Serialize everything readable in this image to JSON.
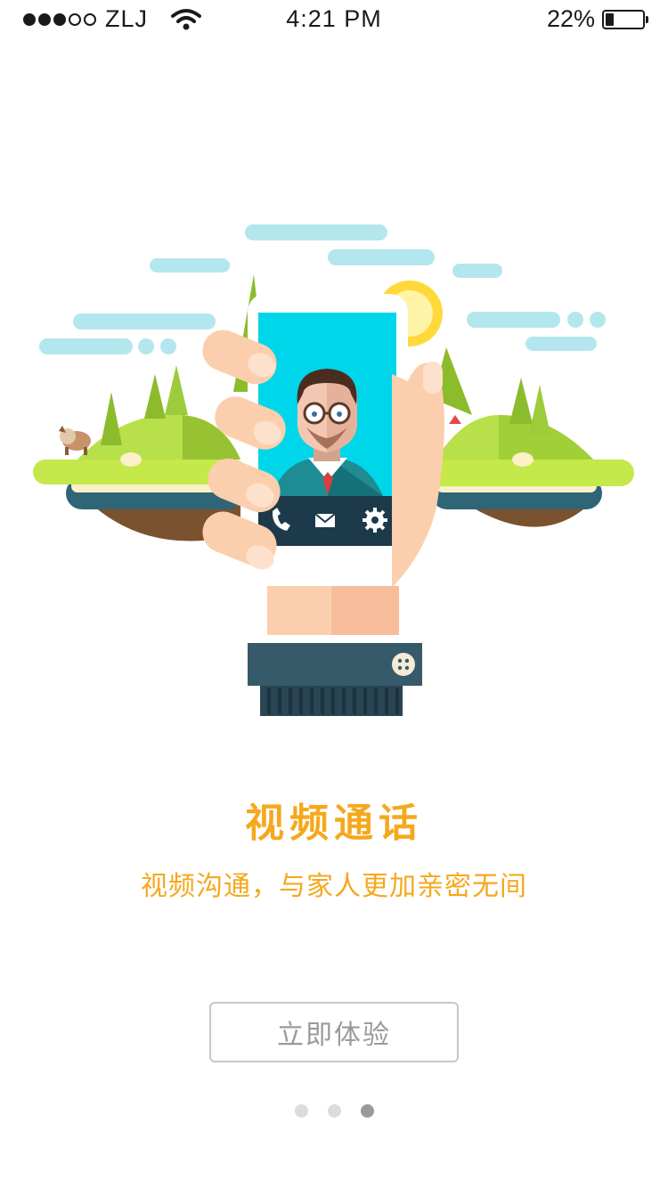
{
  "status_bar": {
    "signal_filled": 3,
    "signal_total": 5,
    "carrier": "ZLJ",
    "time": "4:21 PM",
    "battery_text": "22%",
    "battery_level": 0.22
  },
  "illustration": {
    "icons": [
      "phone-icon",
      "mail-icon",
      "gear-icon"
    ]
  },
  "content": {
    "title": "视频通话",
    "subtitle": "视频沟通，与家人更加亲密无间",
    "cta_label": "立即体验"
  },
  "pager": {
    "total": 3,
    "active_index": 2
  },
  "colors": {
    "accent": "#f5a81e",
    "screen": "#00d6ea",
    "sky": "#b4e6ee",
    "grass": "#b8e04a",
    "sleeve": "#365a6a"
  }
}
